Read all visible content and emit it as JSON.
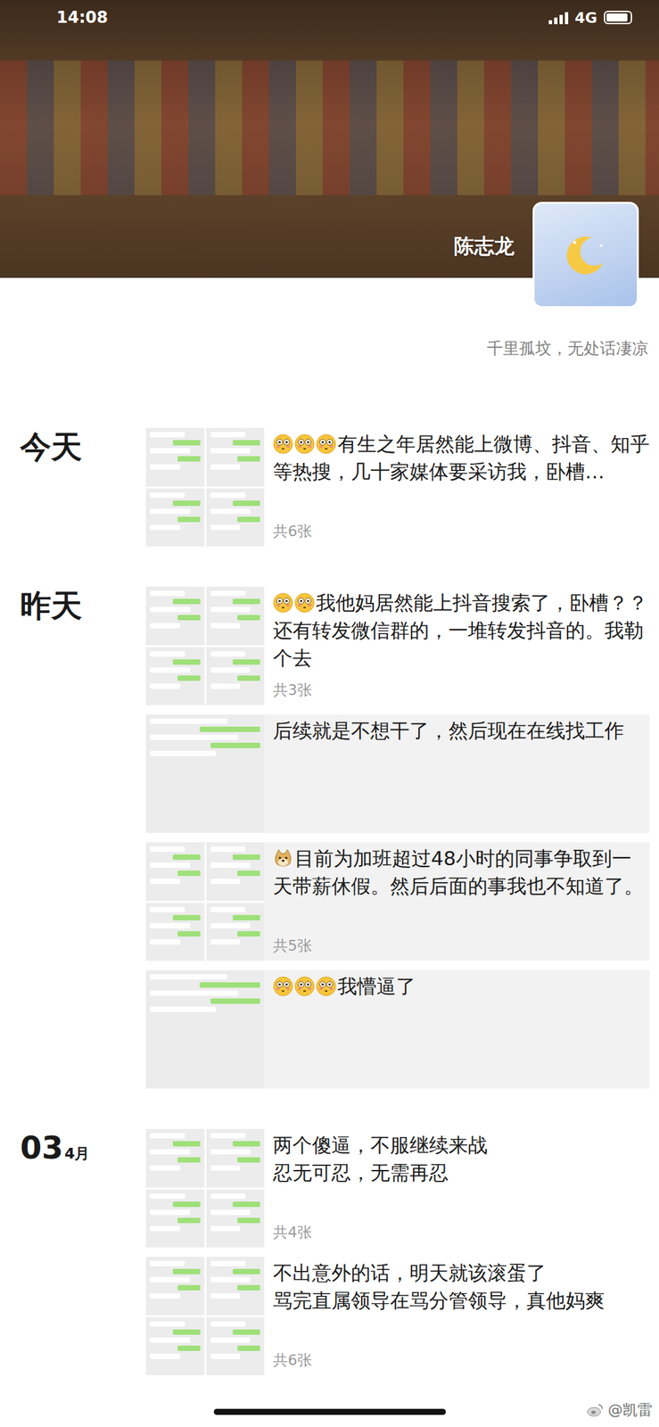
{
  "status_bar": {
    "time": "14:08",
    "network": "4G",
    "signal": {
      "level": 1
    },
    "battery": {
      "level": 0.9
    }
  },
  "profile": {
    "name": "陈志龙",
    "signature": "千里孤坟，无处话凄凉"
  },
  "days": [
    {
      "label": "今天",
      "month": "",
      "posts": [
        {
          "emojis": [
            {
              "kind": "flushed"
            },
            {
              "kind": "flushed"
            },
            {
              "kind": "flushed"
            }
          ],
          "text": "有生之年居然能上微博、抖音、知乎等热搜，几十家媒体要采访我，卧槽…",
          "count": "共6张",
          "shaded": false
        }
      ]
    },
    {
      "label": "昨天",
      "month": "",
      "posts": [
        {
          "emojis": [
            {
              "kind": "flushed"
            },
            {
              "kind": "flushed"
            }
          ],
          "text": "我他妈居然能上抖音搜索了，卧槽？？还有转发微信群的，一堆转发抖音的。我勒个去",
          "count": "共3张",
          "shaded": false
        },
        {
          "emojis": [],
          "text": "后续就是不想干了，然后现在在线找工作",
          "count": "",
          "shaded": true
        },
        {
          "emojis": [
            {
              "kind": "doge"
            }
          ],
          "text": "目前为加班超过48小时的同事争取到一天带薪休假。然后后面的事我也不知道了。",
          "count": "共5张",
          "shaded": true
        },
        {
          "emojis": [
            {
              "kind": "flushed"
            },
            {
              "kind": "flushed"
            },
            {
              "kind": "flushed"
            }
          ],
          "text": "我懵逼了",
          "count": "",
          "shaded": true
        }
      ]
    },
    {
      "label": "03",
      "month": "4月",
      "posts": [
        {
          "emojis": [],
          "text": "两个傻逼，不服继续来战\n忍无可忍，无需再忍",
          "count": "共4张",
          "shaded": false
        },
        {
          "emojis": [],
          "text": "不出意外的话，明天就该滚蛋了\n骂完直属领导在骂分管领导，真他妈爽",
          "count": "共6张",
          "shaded": false
        }
      ]
    }
  ],
  "watermark": "@凯雷"
}
